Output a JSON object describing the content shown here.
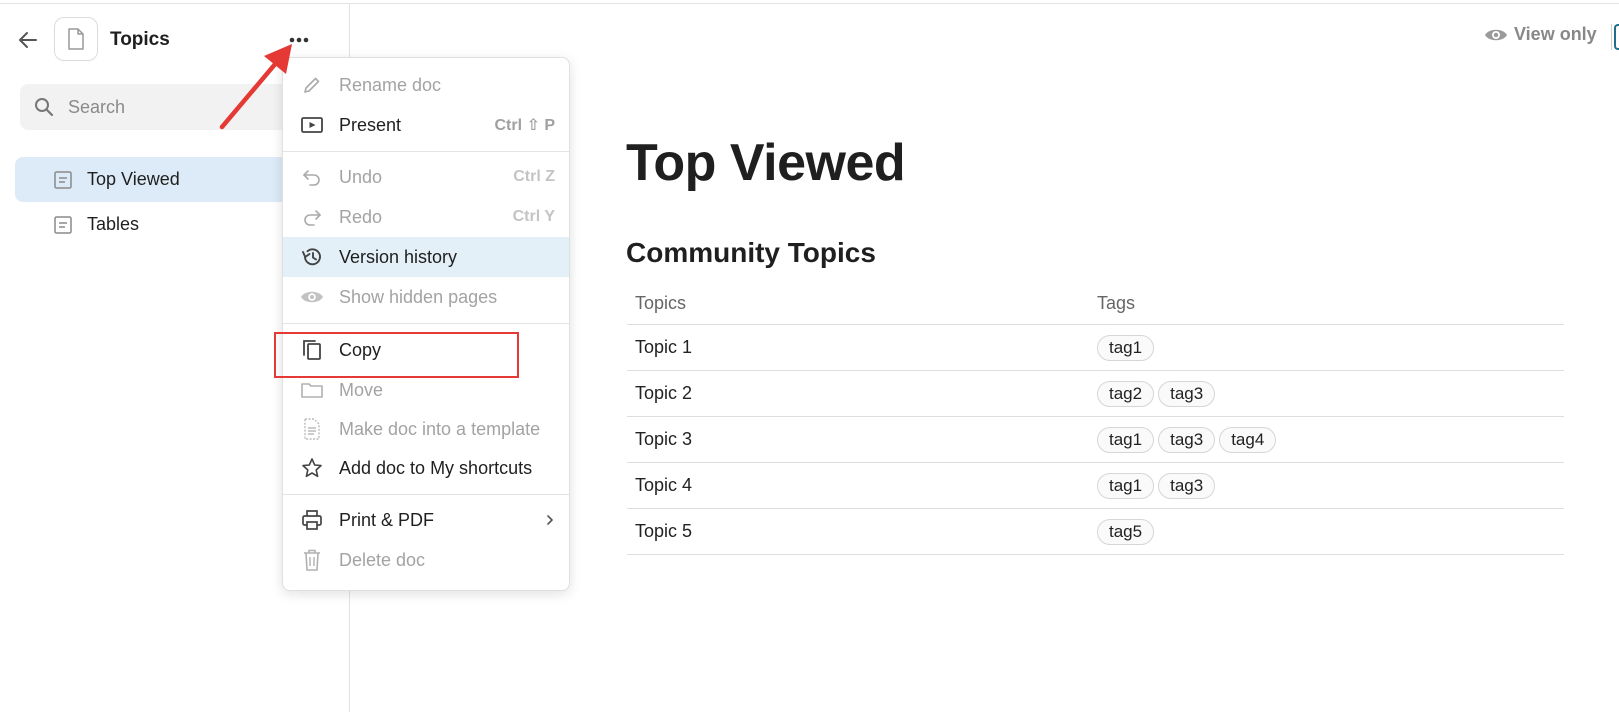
{
  "sidebar": {
    "doc_title": "Topics",
    "search_placeholder": "Search",
    "items": [
      {
        "label": "Top Viewed",
        "active": true
      },
      {
        "label": "Tables",
        "active": false
      }
    ]
  },
  "header": {
    "view_only_label": "View only"
  },
  "main": {
    "title": "Top Viewed",
    "section_title": "Community Topics",
    "table": {
      "columns": [
        "Topics",
        "Tags"
      ],
      "rows": [
        {
          "topic": "Topic 1",
          "tags": [
            "tag1"
          ]
        },
        {
          "topic": "Topic 2",
          "tags": [
            "tag2",
            "tag3"
          ]
        },
        {
          "topic": "Topic 3",
          "tags": [
            "tag1",
            "tag3",
            "tag4"
          ]
        },
        {
          "topic": "Topic 4",
          "tags": [
            "tag1",
            "tag3"
          ]
        },
        {
          "topic": "Topic 5",
          "tags": [
            "tag5"
          ]
        }
      ]
    }
  },
  "menu": {
    "rename": {
      "label": "Rename doc",
      "disabled": true
    },
    "present": {
      "label": "Present",
      "shortcut": "Ctrl ⇧ P"
    },
    "undo": {
      "label": "Undo",
      "shortcut": "Ctrl Z",
      "disabled": true
    },
    "redo": {
      "label": "Redo",
      "shortcut": "Ctrl Y",
      "disabled": true
    },
    "version_history": {
      "label": "Version history",
      "hovered": true
    },
    "show_hidden": {
      "label": "Show hidden pages",
      "disabled": true
    },
    "copy": {
      "label": "Copy"
    },
    "move": {
      "label": "Move",
      "disabled": true
    },
    "make_template": {
      "label": "Make doc into a template",
      "disabled": true
    },
    "add_shortcut": {
      "label": "Add doc to My shortcuts"
    },
    "print_pdf": {
      "label": "Print & PDF"
    },
    "delete": {
      "label": "Delete doc",
      "disabled": true
    }
  },
  "annotations": {
    "arrow_color": "#e53935",
    "highlight_color": "#e53935"
  },
  "colors": {
    "active_nav_bg": "#dcebf7",
    "menu_hover_bg": "#e4f0f8"
  }
}
